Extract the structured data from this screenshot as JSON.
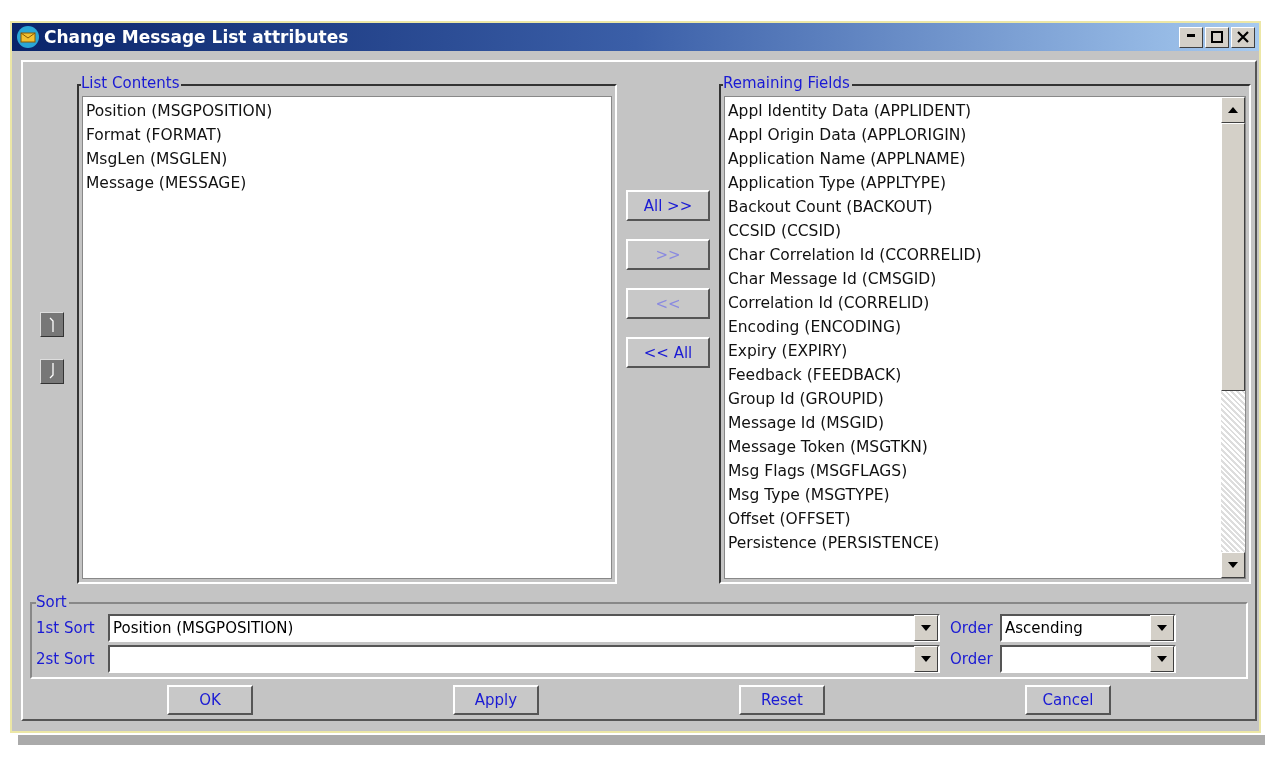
{
  "window": {
    "title": "Change Message List attributes"
  },
  "move_buttons": [
    {
      "kind": "up"
    },
    {
      "kind": "down"
    }
  ],
  "list_contents": {
    "title": "List Contents",
    "items": [
      {
        "label": "Position (MSGPOSITION)"
      },
      {
        "label": "Format (FORMAT)"
      },
      {
        "label": "MsgLen (MSGLEN)"
      },
      {
        "label": "Message (MESSAGE)"
      }
    ]
  },
  "transfer_buttons": [
    {
      "label": "All >>",
      "disabled": false
    },
    {
      "label": ">>",
      "disabled": true
    },
    {
      "label": "<<",
      "disabled": true
    },
    {
      "label": "<< All",
      "disabled": false
    }
  ],
  "remaining_fields": {
    "title": "Remaining Fields",
    "items": [
      {
        "label": "Appl Identity Data (APPLIDENT)"
      },
      {
        "label": "Appl Origin Data (APPLORIGIN)"
      },
      {
        "label": "Application Name (APPLNAME)"
      },
      {
        "label": "Application Type (APPLTYPE)"
      },
      {
        "label": "Backout Count (BACKOUT)"
      },
      {
        "label": "CCSID (CCSID)"
      },
      {
        "label": "Char Correlation Id (CCORRELID)"
      },
      {
        "label": "Char Message Id (CMSGID)"
      },
      {
        "label": "Correlation Id (CORRELID)"
      },
      {
        "label": "Encoding (ENCODING)"
      },
      {
        "label": "Expiry (EXPIRY)"
      },
      {
        "label": "Feedback (FEEDBACK)"
      },
      {
        "label": "Group Id (GROUPID)"
      },
      {
        "label": "Message Id (MSGID)"
      },
      {
        "label": "Message Token (MSGTKN)"
      },
      {
        "label": "Msg Flags (MSGFLAGS)"
      },
      {
        "label": "Msg Type (MSGTYPE)"
      },
      {
        "label": "Offset (OFFSET)"
      },
      {
        "label": "Persistence (PERSISTENCE)"
      }
    ]
  },
  "sort": {
    "title": "Sort",
    "rows": [
      {
        "label": "1st Sort",
        "value": "Position (MSGPOSITION)",
        "order_label": "Order",
        "order_value": "Ascending"
      },
      {
        "label": "2st Sort",
        "order_label": "Order"
      }
    ]
  },
  "buttons": [
    {
      "label": "OK"
    },
    {
      "label": "Apply"
    },
    {
      "label": "Reset"
    },
    {
      "label": "Cancel"
    }
  ]
}
